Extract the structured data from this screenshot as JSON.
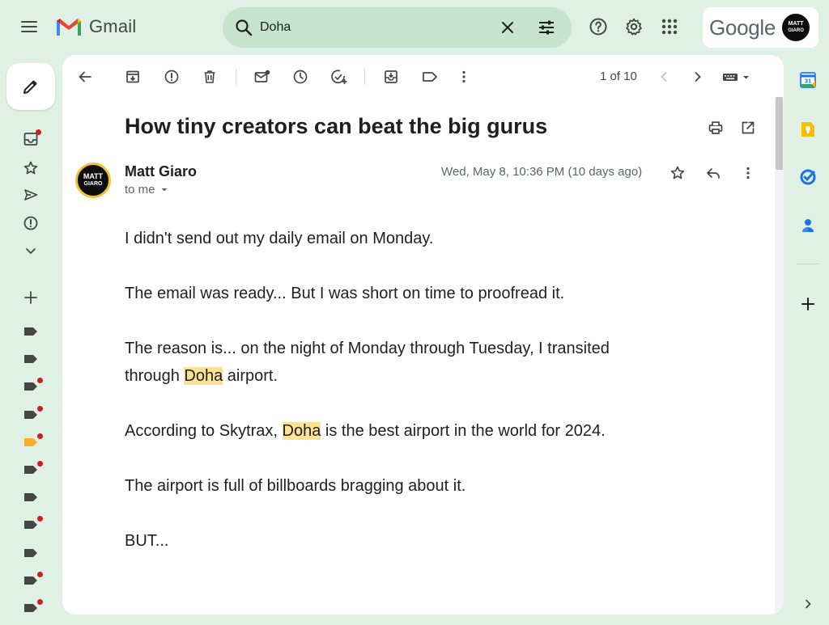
{
  "app": {
    "name": "Gmail",
    "brand_word": "Google"
  },
  "search": {
    "value": "Doha"
  },
  "account": {
    "avatar_line1": "MATT",
    "avatar_line2": "GIARO"
  },
  "toolbar": {
    "pager": "1 of 10"
  },
  "message": {
    "subject": "How tiny creators can beat the big gurus",
    "sender_name": "Matt Giaro",
    "recipient": "to me",
    "date": "Wed, May 8, 10:36 PM (10 days ago)",
    "avatar_line1": "MATT",
    "avatar_line2": "GIARO",
    "highlight_term": "Doha",
    "paragraphs": [
      {
        "before": "I didn't send out my daily email on Monday.",
        "hl": "",
        "after": ""
      },
      {
        "before": "The email was ready... But I was short on time to proofread it.",
        "hl": "",
        "after": ""
      },
      {
        "before": "The reason is... on the night of Monday through Tuesday, I transited through ",
        "hl": "Doha",
        "after": " airport."
      },
      {
        "before": "According to Skytrax, ",
        "hl": "Doha",
        "after": " is the best airport in the world for 2024."
      },
      {
        "before": "The airport is full of billboards bragging about it.",
        "hl": "",
        "after": ""
      },
      {
        "before": "BUT...",
        "hl": "",
        "after": ""
      }
    ]
  },
  "right_apps": {
    "calendar_day": "31"
  },
  "colors": {
    "background": "#dff1e4",
    "search_bg": "#c6e3cd",
    "highlight": "#fde293",
    "unread_dot": "#c5221f",
    "label_orange": "#f6ae2d"
  },
  "labels": [
    {
      "color": "#444746",
      "unread": false
    },
    {
      "color": "#444746",
      "unread": false
    },
    {
      "color": "#444746",
      "unread": true
    },
    {
      "color": "#444746",
      "unread": true
    },
    {
      "color": "#f6ae2d",
      "unread": true
    },
    {
      "color": "#444746",
      "unread": true
    },
    {
      "color": "#444746",
      "unread": false
    },
    {
      "color": "#444746",
      "unread": true
    },
    {
      "color": "#444746",
      "unread": false
    },
    {
      "color": "#444746",
      "unread": true
    },
    {
      "color": "#444746",
      "unread": true
    }
  ]
}
